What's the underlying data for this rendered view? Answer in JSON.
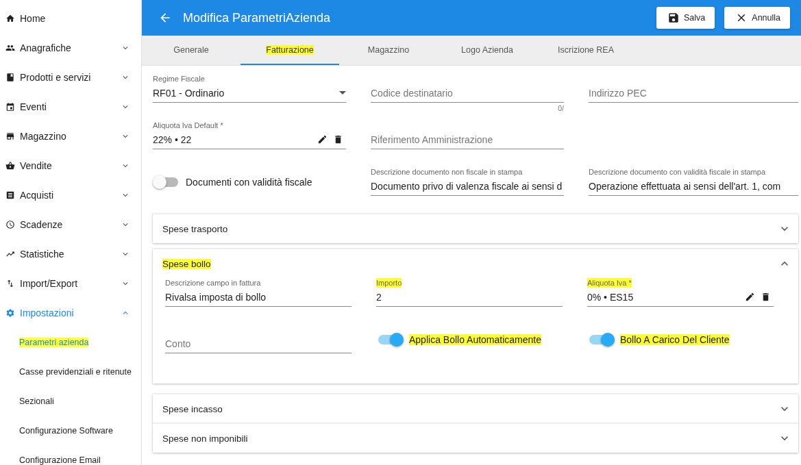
{
  "sidebar": {
    "items": [
      {
        "label": "Home",
        "kind": "link",
        "selected": false
      },
      {
        "label": "Anagrafiche",
        "kind": "group",
        "selected": false,
        "expanded": false
      },
      {
        "label": "Prodotti e servizi",
        "kind": "group",
        "selected": false,
        "expanded": false
      },
      {
        "label": "Eventi",
        "kind": "group",
        "selected": false,
        "expanded": false
      },
      {
        "label": "Magazzino",
        "kind": "group",
        "selected": false,
        "expanded": false
      },
      {
        "label": "Vendite",
        "kind": "group",
        "selected": false,
        "expanded": false
      },
      {
        "label": "Acquisti",
        "kind": "group",
        "selected": false,
        "expanded": false
      },
      {
        "label": "Scadenze",
        "kind": "group",
        "selected": false,
        "expanded": false
      },
      {
        "label": "Statistiche",
        "kind": "group",
        "selected": false,
        "expanded": false
      },
      {
        "label": "Import/Export",
        "kind": "group",
        "selected": false,
        "expanded": false
      },
      {
        "label": "Impostazioni",
        "kind": "group",
        "selected": true,
        "expanded": true,
        "children": [
          {
            "label": "Parametri azienda",
            "selected": true,
            "highlighted": true
          },
          {
            "label": "Casse previdenziali e ritenute",
            "selected": false,
            "highlighted": false
          },
          {
            "label": "Sezionali",
            "selected": false,
            "highlighted": false
          },
          {
            "label": "Configurazione Software",
            "selected": false,
            "highlighted": false
          },
          {
            "label": "Configurazione Email",
            "selected": false,
            "highlighted": false
          }
        ]
      }
    ]
  },
  "header": {
    "title": "Modifica ParametriAzienda",
    "buttons": [
      {
        "label": "Salva",
        "kind": "save"
      },
      {
        "label": "Annulla",
        "kind": "cancel"
      }
    ]
  },
  "tabs": [
    {
      "label": "Generale",
      "selected": false,
      "highlighted": false
    },
    {
      "label": "Fatturazione",
      "selected": true,
      "highlighted": true
    },
    {
      "label": "Magazzino",
      "selected": false,
      "highlighted": false
    },
    {
      "label": "Logo Azienda",
      "selected": false,
      "highlighted": false
    },
    {
      "label": "Iscrizione REA",
      "selected": false,
      "highlighted": false
    }
  ],
  "form": {
    "rows": [
      [
        {
          "kind": "select",
          "label": "Regime Fiscale",
          "value": "RF01 - Ordinario"
        },
        {
          "kind": "text",
          "placeholder": "Codice destinatario",
          "counter": "0/"
        },
        {
          "kind": "text",
          "placeholder": "Indirizzo PEC"
        }
      ],
      [
        {
          "kind": "lookup",
          "label": "Aliquota Iva Default *",
          "value": "22% • 22"
        },
        {
          "kind": "text",
          "placeholder": "Riferimento Amministrazione"
        }
      ],
      [
        {
          "kind": "toggle",
          "label": "Documenti con validità fiscale",
          "on": false,
          "highlighted": false
        },
        {
          "kind": "text",
          "label": "Descrizione documento non fiscale in stampa",
          "value": "Documento privo di valenza fiscale ai sensi d"
        },
        {
          "kind": "text",
          "label": "Descrizione documento con validità fiscale in stampa",
          "value": "Operazione effettuata ai sensi dell'art. 1, com"
        }
      ]
    ]
  },
  "panels": [
    {
      "title": "Spese trasporto",
      "expanded": false,
      "highlighted": false
    },
    {
      "title": "Spese bollo",
      "expanded": true,
      "highlighted": true,
      "rows": [
        [
          {
            "kind": "text",
            "label": "Descrizione campo in fattura",
            "value": "Rivalsa imposta di bollo",
            "highlighted": false
          },
          {
            "kind": "text",
            "label": "Importo",
            "value": "2",
            "highlighted": true
          },
          {
            "kind": "lookup",
            "label": "Aliquota Iva *",
            "value": "0% • ES15",
            "highlighted": true
          }
        ],
        [
          {
            "kind": "text",
            "placeholder": "Conto"
          },
          {
            "kind": "toggle",
            "label": "Applica Bollo Automaticamente",
            "on": true,
            "highlighted": true
          },
          {
            "kind": "toggle",
            "label": "Bollo A Carico Del Cliente",
            "on": true,
            "highlighted": true
          }
        ]
      ]
    },
    {
      "title": "Spese incasso",
      "expanded": false,
      "highlighted": false
    },
    {
      "title": "Spese non imponibili",
      "expanded": false,
      "highlighted": false
    }
  ]
}
